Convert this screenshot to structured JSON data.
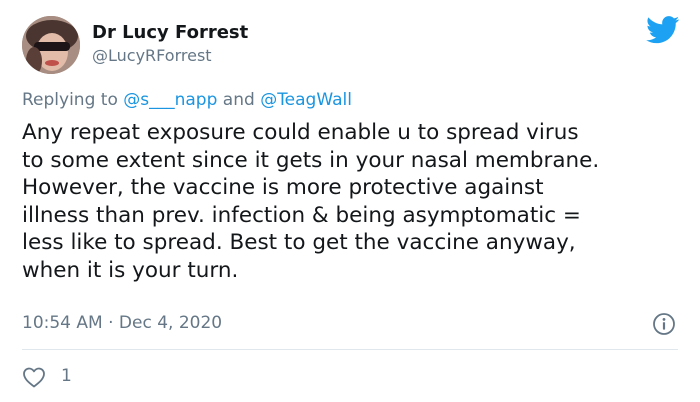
{
  "author": {
    "display_name": "Dr Lucy Forrest",
    "handle": "@LucyRForrest",
    "avatar_icon": "profile-photo"
  },
  "reply_context": {
    "prefix": "Replying to ",
    "mention_1": "@s___napp",
    "connector": " and ",
    "mention_2": "@TeagWall"
  },
  "tweet": {
    "lines": [
      "Any repeat exposure could enable u to spread virus",
      "to some extent since it gets in your nasal membrane.",
      "However, the vaccine is more protective against",
      "illness than prev. infection & being asymptomatic =",
      "less like to spread. Best to get the vaccine anyway,",
      "when it is your turn."
    ]
  },
  "meta": {
    "time": "10:54 AM",
    "separator": " · ",
    "date": "Dec 4, 2020"
  },
  "actions": {
    "like_count": "1",
    "like_icon": "heart-icon",
    "info_icon": "info-icon"
  },
  "brand": {
    "logo_icon": "twitter-bird-icon",
    "twitter_blue": "#1da1f2",
    "mention_color": "#1b95e0",
    "secondary_text": "#657786"
  }
}
